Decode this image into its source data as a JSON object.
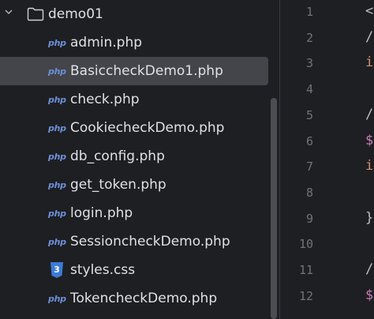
{
  "explorer": {
    "folder": {
      "name": "demo01",
      "icon": "folder-icon",
      "expand_icon": "chevron-down-icon"
    },
    "files": [
      {
        "name": "admin.php",
        "icon": "php-icon",
        "badge": "php",
        "selected": false
      },
      {
        "name": "BasiccheckDemo1.php",
        "icon": "php-icon",
        "badge": "php",
        "selected": true
      },
      {
        "name": "check.php",
        "icon": "php-icon",
        "badge": "php",
        "selected": false
      },
      {
        "name": "CookiecheckDemo.php",
        "icon": "php-icon",
        "badge": "php",
        "selected": false
      },
      {
        "name": "db_config.php",
        "icon": "php-icon",
        "badge": "php",
        "selected": false
      },
      {
        "name": "get_token.php",
        "icon": "php-icon",
        "badge": "php",
        "selected": false
      },
      {
        "name": "login.php",
        "icon": "php-icon",
        "badge": "php",
        "selected": false
      },
      {
        "name": "SessioncheckDemo.php",
        "icon": "php-icon",
        "badge": "php",
        "selected": false
      },
      {
        "name": "styles.css",
        "icon": "css-icon",
        "badge": "",
        "selected": false
      },
      {
        "name": "TokencheckDemo.php",
        "icon": "php-icon",
        "badge": "php",
        "selected": false
      }
    ]
  },
  "editor": {
    "line_numbers": [
      "1",
      "2",
      "3",
      "4",
      "5",
      "6",
      "7",
      "8",
      "9",
      "10",
      "11",
      "12"
    ],
    "code": [
      "<",
      "/",
      "i",
      "",
      "/",
      "$",
      "i",
      "",
      "}",
      "",
      "/",
      "$"
    ]
  },
  "colors": {
    "background": "#1e1f22",
    "selected_row": "#43454a",
    "text": "#dfe1e5",
    "php_icon": "#6c8fd8",
    "css_icon": "#3d7bd6",
    "line_number": "#6f737a",
    "variable": "#c77dbb",
    "keyword": "#cf8e6d"
  }
}
